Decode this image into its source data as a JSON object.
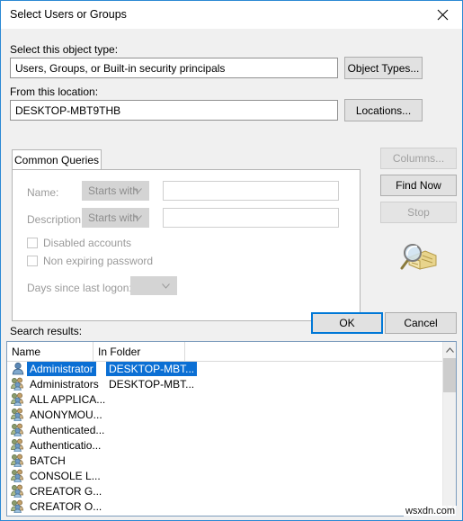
{
  "window": {
    "title": "Select Users or Groups",
    "close_icon": "close-icon",
    "border_color": "#2c89d4"
  },
  "object_type": {
    "label": "Select this object type:",
    "value": "Users, Groups, or Built-in security principals",
    "button_label": "Object Types..."
  },
  "location": {
    "label": "From this location:",
    "value": "DESKTOP-MBT9THB",
    "button_label": "Locations..."
  },
  "tabs": [
    {
      "label": "Common Queries",
      "selected": true
    }
  ],
  "query": {
    "name_label": "Name:",
    "name_condition": "Starts with",
    "name_value": "",
    "description_label": "Description:",
    "description_condition": "Starts with",
    "description_value": "",
    "disabled_accounts_label": "Disabled accounts",
    "disabled_accounts_checked": false,
    "non_expiring_password_label": "Non expiring password",
    "non_expiring_password_checked": false,
    "days_label": "Days since last logon:",
    "days_value": ""
  },
  "side_buttons": {
    "columns_label": "Columns...",
    "columns_enabled": false,
    "find_now_label": "Find Now",
    "find_now_enabled": true,
    "stop_label": "Stop",
    "stop_enabled": false,
    "search_icon": "magnifier-folder-icon"
  },
  "dialog_buttons": {
    "ok_label": "OK",
    "ok_is_default": true,
    "cancel_label": "Cancel"
  },
  "results": {
    "label": "Search results:",
    "columns": [
      "Name",
      "In Folder"
    ],
    "rows": [
      {
        "name": "Administrator",
        "folder": "DESKTOP-MBT...",
        "icon": "user-icon",
        "selected": true
      },
      {
        "name": "Administrators",
        "folder": "DESKTOP-MBT...",
        "icon": "group-icon",
        "selected": false
      },
      {
        "name": "ALL APPLICA...",
        "folder": "",
        "icon": "group-icon",
        "selected": false
      },
      {
        "name": "ANONYMOU...",
        "folder": "",
        "icon": "group-icon",
        "selected": false
      },
      {
        "name": "Authenticated...",
        "folder": "",
        "icon": "group-icon",
        "selected": false
      },
      {
        "name": "Authenticatio...",
        "folder": "",
        "icon": "group-icon",
        "selected": false
      },
      {
        "name": "BATCH",
        "folder": "",
        "icon": "group-icon",
        "selected": false
      },
      {
        "name": "CONSOLE L...",
        "folder": "",
        "icon": "group-icon",
        "selected": false
      },
      {
        "name": "CREATOR G...",
        "folder": "",
        "icon": "group-icon",
        "selected": false
      },
      {
        "name": "CREATOR O...",
        "folder": "",
        "icon": "group-icon",
        "selected": false
      }
    ],
    "selection_color": "#0b6fd4",
    "scrollbar": {
      "up_icon": "chevron-up-icon",
      "down_icon": "chevron-down-icon"
    }
  },
  "watermark": {
    "text": "wsxdn.com"
  }
}
